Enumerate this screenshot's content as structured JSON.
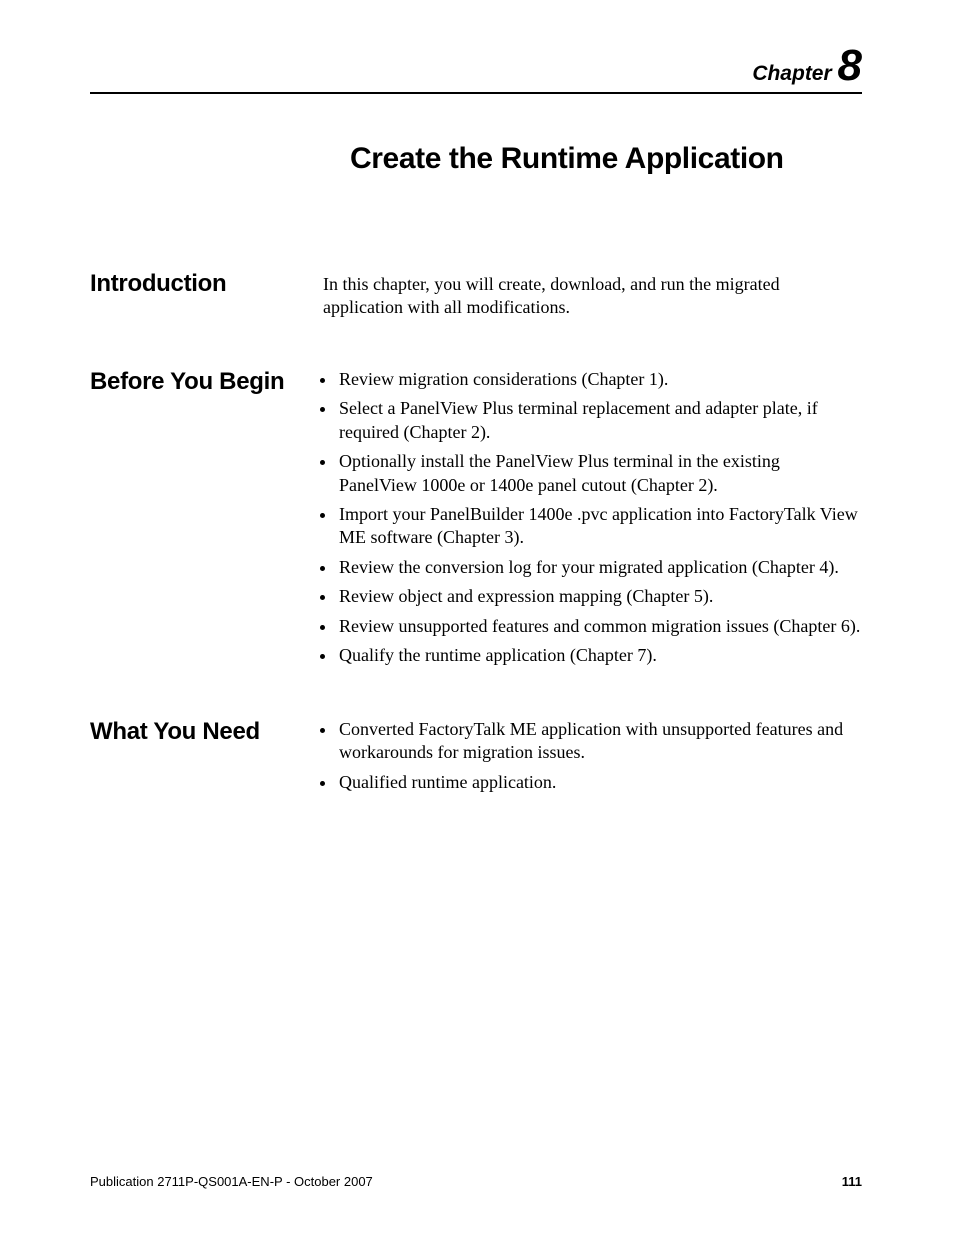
{
  "chapter": {
    "label": "Chapter",
    "number": "8"
  },
  "page_title": "Create the Runtime Application",
  "sections": {
    "introduction": {
      "heading": "Introduction",
      "text": "In this chapter, you will create, download, and run the migrated application with all modifications."
    },
    "before_you_begin": {
      "heading": "Before You Begin",
      "items": [
        "Review migration considerations (Chapter 1).",
        "Select a PanelView Plus terminal replacement and adapter plate, if required (Chapter 2).",
        "Optionally install the PanelView Plus terminal in the existing PanelView 1000e or 1400e panel cutout (Chapter 2).",
        "Import your PanelBuilder 1400e .pvc application into FactoryTalk View ME software (Chapter 3).",
        "Review the conversion log for your migrated application (Chapter 4).",
        "Review object and expression mapping (Chapter 5).",
        "Review unsupported features and common migration issues (Chapter 6).",
        "Qualify the runtime application (Chapter 7)."
      ]
    },
    "what_you_need": {
      "heading": "What You Need",
      "items": [
        "Converted FactoryTalk ME application with unsupported features and workarounds for migration issues.",
        "Qualified runtime application."
      ]
    }
  },
  "footer": {
    "publication": "Publication 2711P-QS001A-EN-P - October 2007",
    "page_number": "111"
  }
}
